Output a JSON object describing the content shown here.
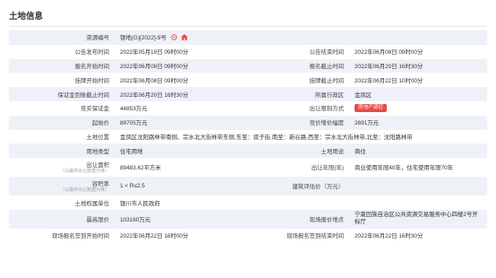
{
  "page_title": "土地信息",
  "icons": {
    "info": "info-circle-icon",
    "home": "home-icon",
    "accent": "#e84a4a"
  },
  "rows": [
    {
      "l1": "资源编号",
      "v1": "银地(G)[2022]-9号"
    },
    {
      "l1": "公告发布时间",
      "v1": "2022年05月19日 09时00分",
      "l2": "公告结束时间",
      "v2": "2022年06月08日 09时00分"
    },
    {
      "l1": "报名开始时间",
      "v1": "2022年06月08日 09时00分",
      "l2": "报名截止时间",
      "v2": "2022年06月20日 16时30分"
    },
    {
      "l1": "挂牌开始时间",
      "v1": "2022年06月08日 09时00分",
      "l2": "挂牌截止时间",
      "v2": "2022年06月22日 10时00分"
    },
    {
      "l1": "保证金到账截止时间",
      "v1": "2022年06月20日 16时30分",
      "l2": "所属行政区",
      "v2": "金凤区"
    },
    {
      "l1": "竞买保证金",
      "v1": "44853万元",
      "l2": "出让限制方式",
      "v2": "房地产调控"
    },
    {
      "l1": "起始价",
      "v1": "89705万元",
      "l2": "竞价增价幅度",
      "v2": "2691万元"
    },
    {
      "l1": "土地位置",
      "v1": "金凤区沈阳路林带南侧、宗水北大街林带东侧,东至：双子街,南至：新谷路,西至：宗水北大街林带,北至：沈阳路林带"
    },
    {
      "l1": "用地类型",
      "v1": "住宅用地",
      "l2": "土地用途",
      "v2": "商住"
    },
    {
      "l1": "出让面积",
      "s1": "（以最终出让数据为准）",
      "v1": "89483.62平方米",
      "l2": "出让年限(年)",
      "v2": "商业使用年限40年，住宅使用年限70年"
    },
    {
      "l1": "容积率",
      "s1": "（以最终出让数据为准）",
      "v1": "1 < R≤2.5",
      "l2": "建筑评估价（万元）",
      "v2": ""
    },
    {
      "l1": "土地权属单位",
      "v1": "银川市人民政府"
    },
    {
      "l1": "最高限价",
      "v1": "103160万元",
      "l2": "现场报价地点",
      "v2": "宁夏回族自治区公共资源交易服务中心四楼2号开标厅"
    },
    {
      "l1": "现场报名签到开始时间",
      "v1": "2022年06月22日 16时00分",
      "l2": "现场报名签到结束时间",
      "v2": "2022年06月22日 16时30分"
    }
  ]
}
